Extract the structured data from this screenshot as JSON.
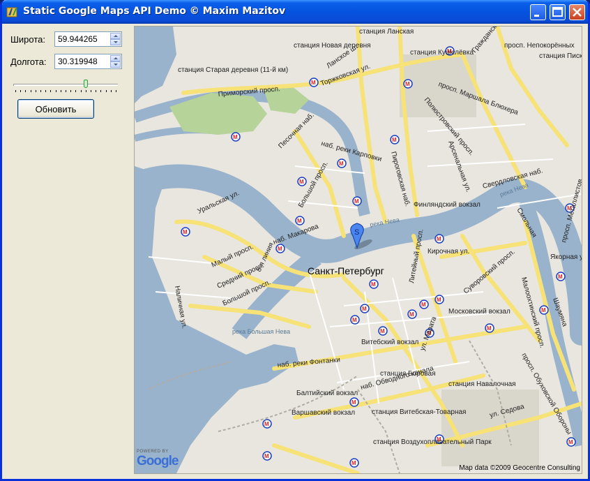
{
  "window": {
    "title": "Static Google Maps API Demo © Maxim Mazitov",
    "controls": {
      "minimize": "minimize",
      "maximize": "maximize",
      "close": "close"
    }
  },
  "form": {
    "latitude_label": "Широта:",
    "latitude_value": "59.944265",
    "longitude_label": "Долгота:",
    "longitude_value": "30.319948",
    "zoom_level_fraction": 0.7,
    "update_button": "Обновить"
  },
  "map": {
    "city_label": "Санкт-Петербург",
    "marker_letter": "S",
    "powered_by": "POWERED BY",
    "logo": "Google",
    "attribution": "Map data ©2009 Geocentre Consulting",
    "labels": [
      "станция Ланская",
      "станция Новая деревня",
      "Ланское ш.",
      "Торжковская ул.",
      "станция Кушелёвка",
      "просп. Непокорённых",
      "станция Пискарёвка",
      "Гражданский",
      "станция Старая деревня (11-й км)",
      "Приморский просп.",
      "просп. Маршала Блюхера",
      "Полюстровский просп.",
      "Песочная наб.",
      "наб. реки Карповки",
      "Пироговская наб.",
      "Арсенальная ул.",
      "Большой просп.",
      "Финляндский вокзал",
      "Свердловская наб.",
      "река Нева",
      "Уральская ул.",
      "наб. Макарова",
      "Малый просп.",
      "Средний просп.",
      "Большой просп.",
      "8-я линия",
      "Наличная ул.",
      "Кирочная ул.",
      "Литейный просп.",
      "Суворовский просп.",
      "Якорная ул.",
      "просп. Металлистов",
      "Московский вокзал",
      "Витебский вокзал",
      "река Большая Нева",
      "наб. реки Фонтанки",
      "наб. Обводного канала",
      "Балтийский вокзал",
      "станция Боровая",
      "станция Навалочная",
      "Варшавский вокзал",
      "станция Витебская-Товарная",
      "станция Воздухоплавательный Парк",
      "ул. Седова",
      "просп. Обуховской Обороны",
      "Малоохтинский просп.",
      "Шаумяна",
      "река Нева",
      "Смольная",
      "ул. Марата"
    ]
  }
}
